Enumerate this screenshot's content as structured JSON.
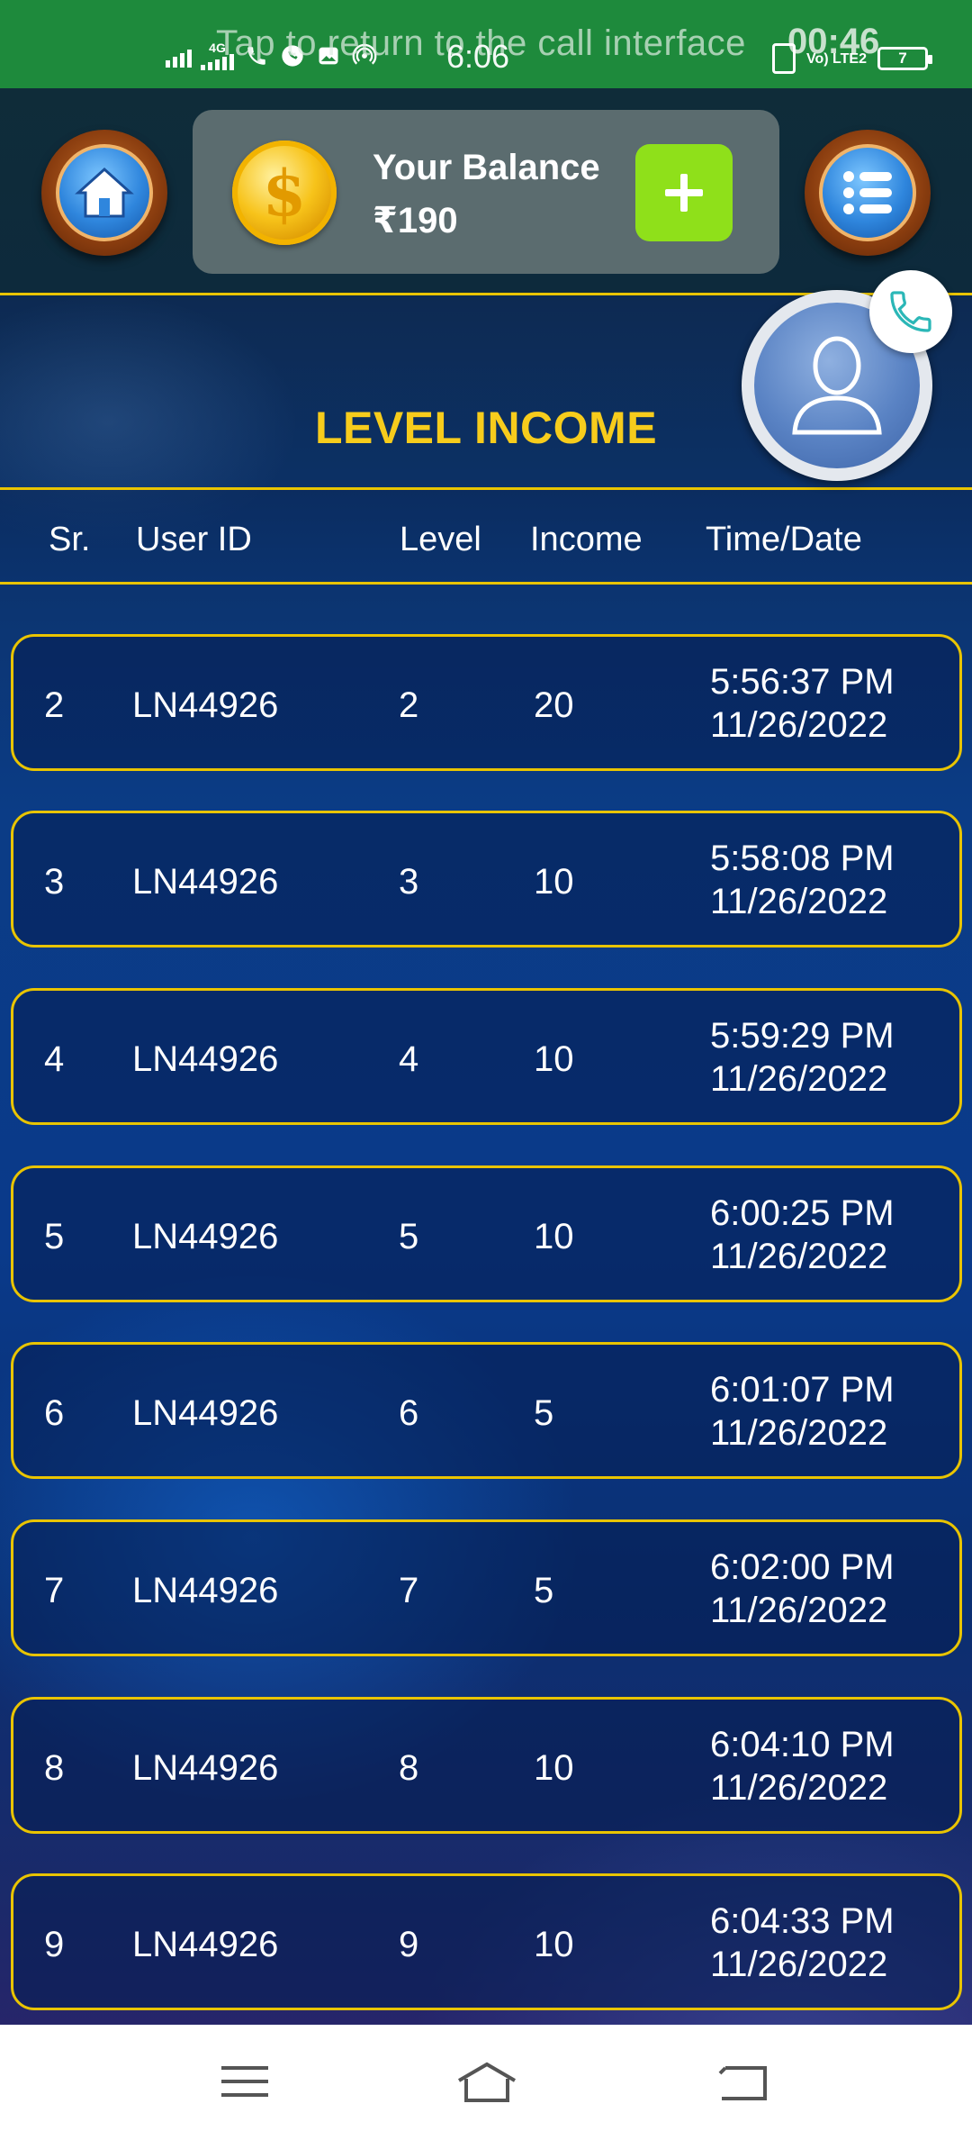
{
  "status_bar": {
    "network": "4G",
    "time": "6:06",
    "call_banner": "Tap to return to the call interface",
    "call_timer": "00:46",
    "lte": "Vo) LTE2",
    "battery": "7"
  },
  "header": {
    "balance_label": "Your Balance",
    "balance_value": "₹190",
    "add_button": "+",
    "home_icon": "home-icon",
    "menu_icon": "list-menu-icon",
    "coin_symbol": "$"
  },
  "page": {
    "title": "LEVEL INCOME"
  },
  "table": {
    "columns": [
      "Sr.",
      "User ID",
      "Level",
      "Income",
      "Time/Date"
    ],
    "rows": [
      {
        "sr": "2",
        "user_id": "LN44926",
        "level": "2",
        "income": "20",
        "time": "5:56:37 PM",
        "date": "11/26/2022"
      },
      {
        "sr": "3",
        "user_id": "LN44926",
        "level": "3",
        "income": "10",
        "time": "5:58:08 PM",
        "date": "11/26/2022"
      },
      {
        "sr": "4",
        "user_id": "LN44926",
        "level": "4",
        "income": "10",
        "time": "5:59:29 PM",
        "date": "11/26/2022"
      },
      {
        "sr": "5",
        "user_id": "LN44926",
        "level": "5",
        "income": "10",
        "time": "6:00:25 PM",
        "date": "11/26/2022"
      },
      {
        "sr": "6",
        "user_id": "LN44926",
        "level": "6",
        "income": "5",
        "time": "6:01:07 PM",
        "date": "11/26/2022"
      },
      {
        "sr": "7",
        "user_id": "LN44926",
        "level": "7",
        "income": "5",
        "time": "6:02:00 PM",
        "date": "11/26/2022"
      },
      {
        "sr": "8",
        "user_id": "LN44926",
        "level": "8",
        "income": "10",
        "time": "6:04:10 PM",
        "date": "11/26/2022"
      },
      {
        "sr": "9",
        "user_id": "LN44926",
        "level": "9",
        "income": "10",
        "time": "6:04:33 PM",
        "date": "11/26/2022"
      }
    ]
  },
  "colors": {
    "accent_yellow": "#f7cc1c",
    "border_yellow": "#e9c400",
    "add_green": "#8fe01a",
    "status_green": "#1e8a3c"
  }
}
